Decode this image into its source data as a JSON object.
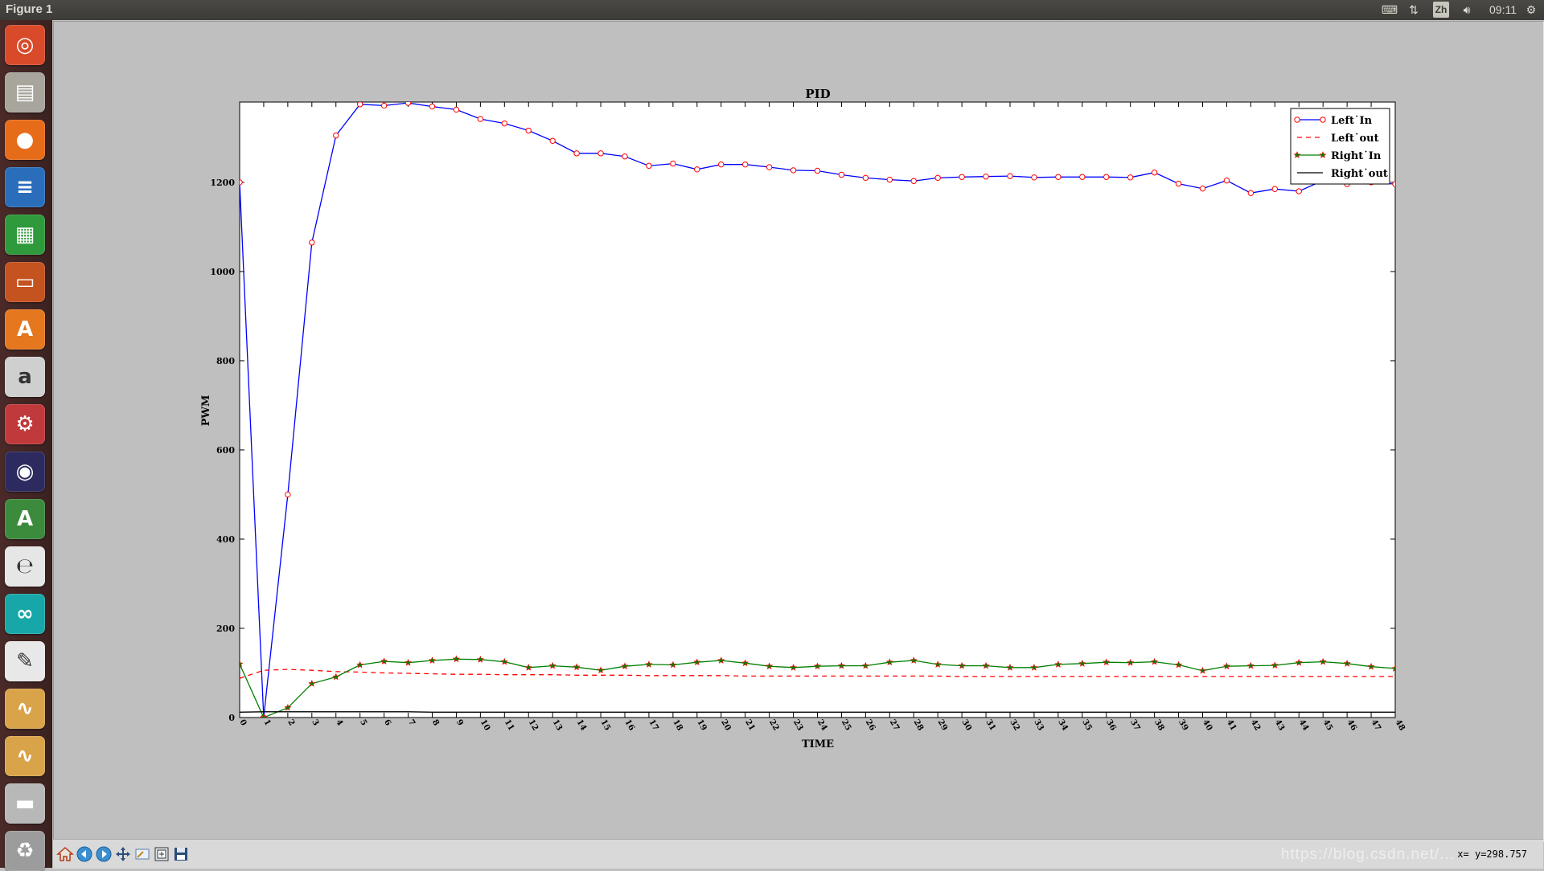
{
  "window": {
    "title": "Figure 1"
  },
  "topbar": {
    "lang": "Zh",
    "clock": "09:11"
  },
  "launcher": {
    "items": [
      {
        "name": "ubuntu-dash-icon",
        "glyph": "◎",
        "bg": "#d84a2a"
      },
      {
        "name": "files-icon",
        "glyph": "▤",
        "bg": "#a8a59d"
      },
      {
        "name": "firefox-icon",
        "glyph": "●",
        "bg": "#e66c1a"
      },
      {
        "name": "writer-icon",
        "glyph": "≡",
        "bg": "#2a6ebb"
      },
      {
        "name": "calc-icon",
        "glyph": "▦",
        "bg": "#2f9a3b"
      },
      {
        "name": "impress-icon",
        "glyph": "▭",
        "bg": "#c4531f"
      },
      {
        "name": "software-center-icon",
        "glyph": "A",
        "bg": "#e5771e"
      },
      {
        "name": "amazon-icon",
        "glyph": "a",
        "bg": "#cfcfcf"
      },
      {
        "name": "settings-icon",
        "glyph": "⚙",
        "bg": "#c0393b"
      },
      {
        "name": "eclipse-icon",
        "glyph": "◉",
        "bg": "#2c2a5f"
      },
      {
        "name": "updater-icon",
        "glyph": "A",
        "bg": "#3c8a3c"
      },
      {
        "name": "pdf-viewer-icon",
        "glyph": "℮",
        "bg": "#e6e6e6"
      },
      {
        "name": "arduino-icon",
        "glyph": "∞",
        "bg": "#18a7a8"
      },
      {
        "name": "text-editor-icon",
        "glyph": "✎",
        "bg": "#e8e8e8"
      },
      {
        "name": "oscilloscope-icon",
        "glyph": "∿",
        "bg": "#d9a34a"
      },
      {
        "name": "oscilloscope2-icon",
        "glyph": "∿",
        "bg": "#d9a34a"
      },
      {
        "name": "disk-icon",
        "glyph": "▬",
        "bg": "#b8b8b8"
      },
      {
        "name": "trash-icon",
        "glyph": "♻",
        "bg": "#9c9c9c"
      }
    ]
  },
  "statusbar": {
    "coords": "x= y=298.757",
    "watermark": "https://blog.csdn.net/..."
  },
  "chart_data": {
    "type": "line",
    "title": "PID",
    "xlabel": "TIME",
    "ylabel": "PWM",
    "xlim": [
      0,
      48
    ],
    "ylim": [
      0,
      1380
    ],
    "xticks": [
      0,
      1,
      2,
      3,
      4,
      5,
      6,
      7,
      8,
      9,
      10,
      11,
      12,
      13,
      14,
      15,
      16,
      17,
      18,
      19,
      20,
      21,
      22,
      23,
      24,
      25,
      26,
      27,
      28,
      29,
      30,
      31,
      32,
      33,
      34,
      35,
      36,
      37,
      38,
      39,
      40,
      41,
      42,
      43,
      44,
      45,
      46,
      47,
      48
    ],
    "yticks": [
      0,
      200,
      400,
      600,
      800,
      1000,
      1200
    ],
    "grid": false,
    "legend_position": "top-right",
    "series": [
      {
        "name": "Left_In",
        "color": "#0000ff",
        "marker": "o",
        "markercolor": "#ff0000",
        "dash": "",
        "values": [
          1200,
          0,
          500,
          1065,
          1305,
          1375,
          1372,
          1378,
          1370,
          1363,
          1342,
          1332,
          1316,
          1293,
          1265,
          1265,
          1258,
          1237,
          1242,
          1229,
          1240,
          1240,
          1234,
          1227,
          1226,
          1217,
          1210,
          1206,
          1203,
          1210,
          1212,
          1213,
          1214,
          1211,
          1212,
          1212,
          1212,
          1211,
          1222,
          1197,
          1186,
          1204,
          1176,
          1185,
          1180,
          1204,
          1196,
          1200,
          1196
        ]
      },
      {
        "name": "Left_out",
        "color": "#ff0000",
        "marker": "",
        "dash": "6,5",
        "values": [
          88,
          106,
          108,
          106,
          103,
          102,
          100,
          99,
          98,
          97,
          97,
          96,
          96,
          96,
          95,
          95,
          95,
          94,
          94,
          94,
          94,
          93,
          93,
          93,
          93,
          93,
          93,
          93,
          93,
          93,
          92,
          92,
          92,
          92,
          92,
          92,
          92,
          92,
          92,
          92,
          92,
          92,
          92,
          92,
          92,
          92,
          92,
          92,
          92
        ]
      },
      {
        "name": "Right_In",
        "color": "#008000",
        "marker": "*",
        "markercolor": "#ff0000",
        "dash": "",
        "values": [
          120,
          0,
          22,
          76,
          91,
          118,
          126,
          123,
          128,
          131,
          130,
          125,
          112,
          116,
          113,
          106,
          115,
          119,
          118,
          124,
          128,
          122,
          115,
          112,
          115,
          116,
          116,
          124,
          128,
          119,
          116,
          116,
          112,
          112,
          119,
          121,
          124,
          123,
          125,
          118,
          105,
          115,
          116,
          117,
          123,
          125,
          121,
          114,
          110
        ]
      },
      {
        "name": "Right_out",
        "color": "#000000",
        "marker": "",
        "dash": "",
        "values": [
          12,
          13,
          13,
          13,
          13,
          13,
          13,
          13,
          12,
          12,
          12,
          12,
          12,
          12,
          12,
          12,
          12,
          12,
          12,
          12,
          12,
          12,
          12,
          12,
          12,
          12,
          12,
          12,
          12,
          12,
          12,
          12,
          12,
          12,
          12,
          12,
          12,
          12,
          12,
          12,
          12,
          12,
          12,
          12,
          12,
          12,
          12,
          12,
          12
        ]
      }
    ],
    "legend": [
      "Left_In",
      "Left_out",
      "Right_In",
      "Right_out"
    ]
  }
}
